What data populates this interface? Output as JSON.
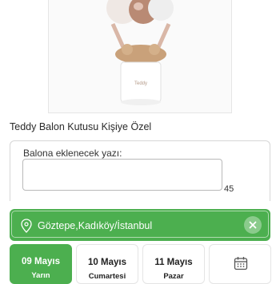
{
  "product": {
    "title": "Teddy Balon Kutusu Kişiye Özel",
    "box_brand": "Teddy"
  },
  "balloon_text": {
    "label": "Balona eklenecek yazı:",
    "value": "",
    "counter": "45"
  },
  "location": {
    "text": "Göztepe,Kadıköy/İstanbul",
    "accent": "#4caf4f"
  },
  "delivery_dates": [
    {
      "day": "09 Mayıs",
      "sub": "Yarın",
      "selected": true
    },
    {
      "day": "10 Mayıs",
      "sub": "Cumartesi",
      "selected": false
    },
    {
      "day": "11 Mayıs",
      "sub": "Pazar",
      "selected": false
    }
  ],
  "calendar": {
    "icon": "calendar-icon"
  }
}
